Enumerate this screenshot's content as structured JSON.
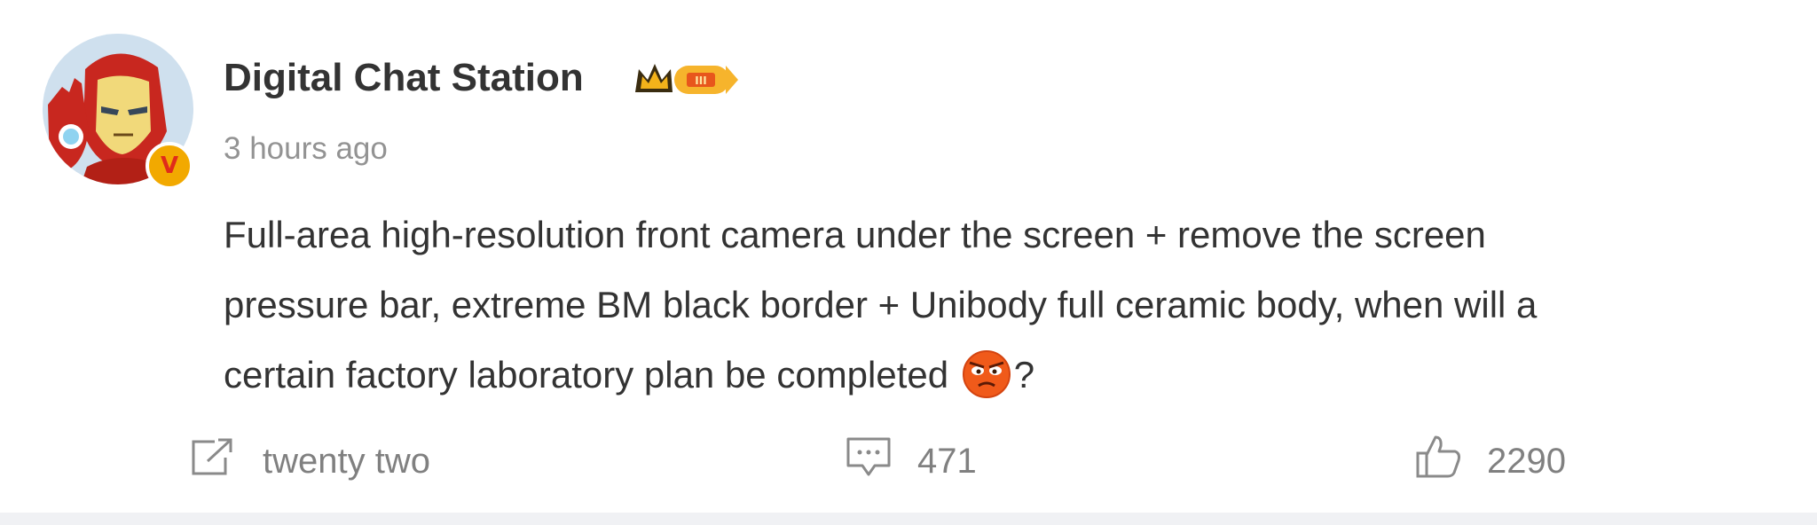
{
  "post": {
    "author": "Digital Chat Station",
    "timestamp": "3 hours ago",
    "verified_badge_letter": "V",
    "vip_level": "III",
    "text_lines": [
      "Full-area high-resolution front camera under the screen + remove the screen",
      "pressure bar, extreme BM black border + Unibody full ceramic body, when will a",
      "certain factory laboratory plan be completed"
    ],
    "text_trailing": "?",
    "emoji": "angry-face"
  },
  "actions": {
    "repost_count": "twenty two",
    "comment_count": "471",
    "like_count": "2290"
  },
  "colors": {
    "text_primary": "#333333",
    "text_secondary": "#939393",
    "action_gray": "#808080",
    "divider_strip": "#f0f1f4",
    "badge_gold": "#f2a900"
  }
}
